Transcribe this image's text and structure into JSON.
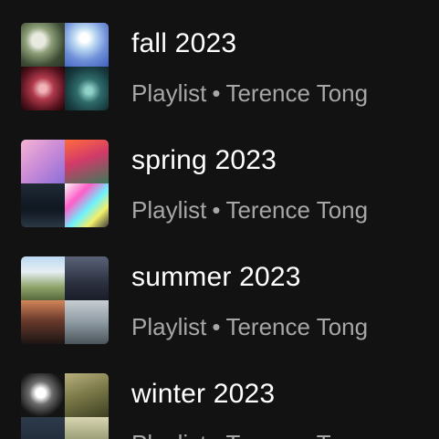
{
  "playlists": [
    {
      "title": "fall 2023",
      "type": "Playlist",
      "separator": "•",
      "owner": "Terence Tong"
    },
    {
      "title": "spring 2023",
      "type": "Playlist",
      "separator": "•",
      "owner": "Terence Tong"
    },
    {
      "title": "summer 2023",
      "type": "Playlist",
      "separator": "•",
      "owner": "Terence Tong"
    },
    {
      "title": "winter 2023",
      "type": "Playlist",
      "separator": "•",
      "owner": "Terence Tong"
    }
  ],
  "colors": {
    "background": "#121212",
    "title": "#ffffff",
    "subtitle": "#a7a7a7"
  }
}
